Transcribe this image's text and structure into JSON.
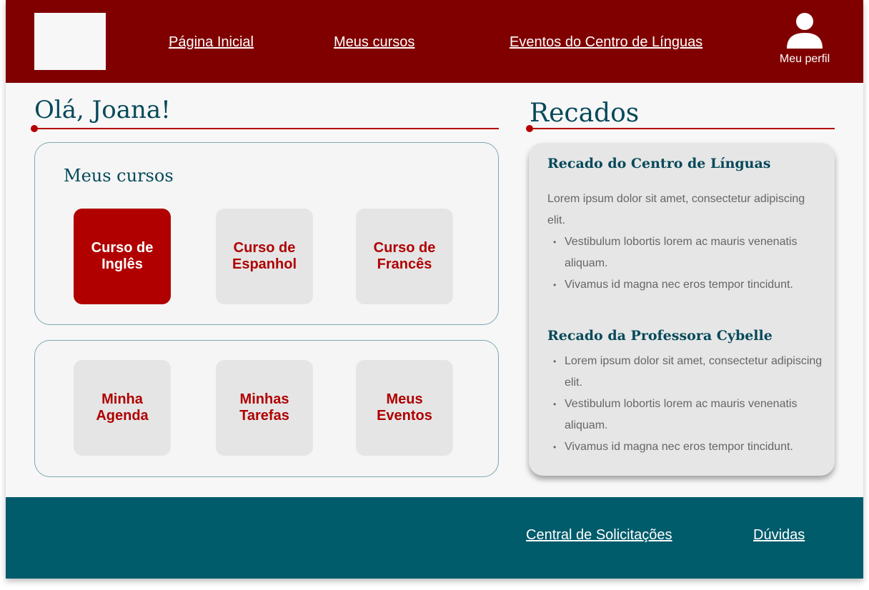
{
  "header": {
    "nav": [
      "Página Inicial",
      "Meus cursos",
      "Eventos do Centro de Línguas"
    ],
    "profile_label": "Meu perfil"
  },
  "greeting": "Olá, Joana!",
  "courses": {
    "title": "Meus cursos",
    "items": [
      "Curso de Inglês",
      "Curso de Espanhol",
      "Curso de Francês"
    ]
  },
  "shortcuts": [
    "Minha Agenda",
    "Minhas Tarefas",
    "Meus Eventos"
  ],
  "recados": {
    "title": "Recados",
    "messages": [
      {
        "title": "Recado do Centro de Línguas",
        "text": "Lorem ipsum dolor sit amet, consectetur adipiscing elit.",
        "bullets": [
          "Vestibulum lobortis lorem ac mauris venenatis aliquam.",
          "Vivamus id magna nec eros tempor tincidunt."
        ]
      },
      {
        "title": "Recado da Professora Cybelle",
        "bullets": [
          "Lorem ipsum dolor sit amet, consectetur adipiscing elit.",
          "Vestibulum lobortis lorem ac mauris venenatis aliquam.",
          "Vivamus id magna nec eros tempor tincidunt."
        ]
      }
    ]
  },
  "footer": {
    "links": [
      "Central de Solicitações",
      "Dúvidas"
    ]
  },
  "colors": {
    "header_bg": "#800000",
    "footer_bg": "#005b6b",
    "accent_red": "#b00000",
    "heading_teal": "#06495a"
  }
}
